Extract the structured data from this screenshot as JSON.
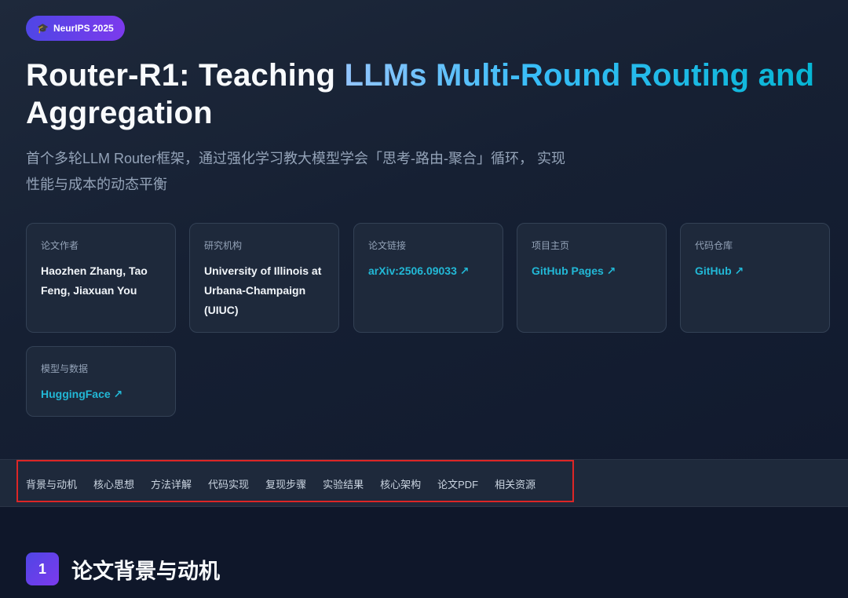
{
  "badge": {
    "icon": "graduation-cap-icon",
    "glyph": "🎓",
    "text": "NeurIPS 2025"
  },
  "title": {
    "part1": "Router-R1: Teaching ",
    "part2": "LLMs Multi-Round Routing and",
    "part3": "Aggregation"
  },
  "subtitle": {
    "line1": "首个多轮LLM Router框架，通过强化学习教大模型学会「思考-路由-聚合」循环， 实现",
    "line2": "性能与成本的动态平衡"
  },
  "cards": {
    "authors": {
      "label": "论文作者",
      "value": "Haozhen Zhang, Tao Feng, Jiaxuan You"
    },
    "institution": {
      "label": "研究机构",
      "value": "University of Illinois at Urbana-Champaign (UIUC)"
    },
    "paper": {
      "label": "论文链接",
      "link": "arXiv:2506.09033 ↗"
    },
    "homepage": {
      "label": "项目主页",
      "link": "GitHub Pages ↗"
    },
    "code": {
      "label": "代码仓库",
      "link": "GitHub ↗"
    },
    "models": {
      "label": "模型与数据",
      "link": "HuggingFace ↗"
    }
  },
  "nav": {
    "items": [
      "背景与动机",
      "核心思想",
      "方法详解",
      "代码实现",
      "复现步骤",
      "实验结果",
      "核心架构",
      "论文PDF",
      "相关资源"
    ]
  },
  "section": {
    "number": "1",
    "title": "论文背景与动机"
  },
  "colors": {
    "accent_link": "#22b8d6",
    "badge_gradient_start": "#4f46e5",
    "badge_gradient_end": "#7c3aed",
    "highlight_box": "#dc2626"
  }
}
